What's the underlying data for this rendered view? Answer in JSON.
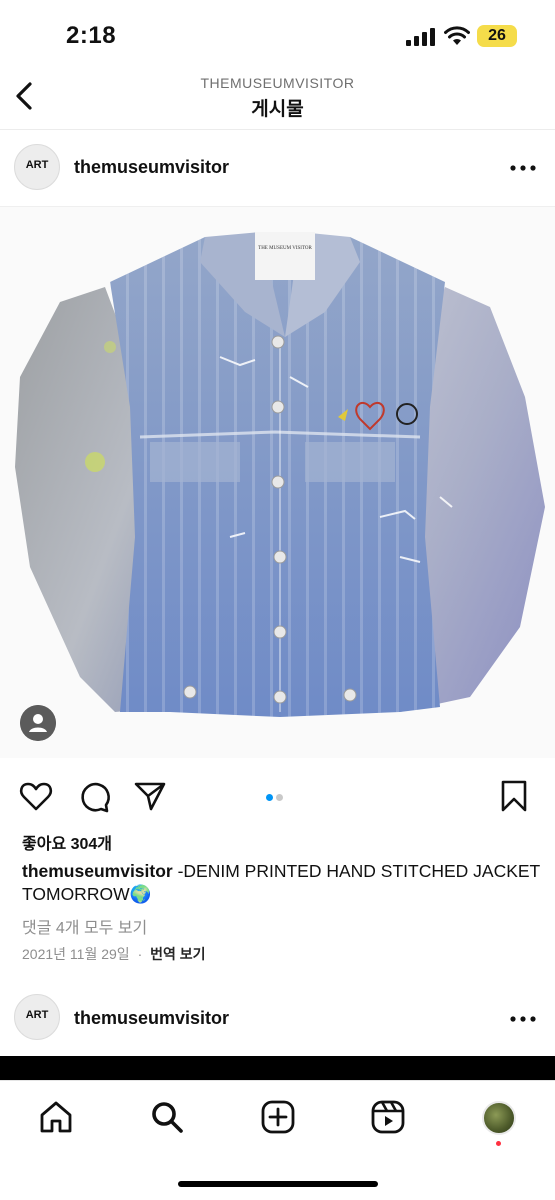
{
  "status_bar": {
    "time": "2:18",
    "battery": "26"
  },
  "header": {
    "account": "THEMUSEUMVISITOR",
    "title": "게시물"
  },
  "post": {
    "avatar_text": "ART",
    "username": "themuseumvisitor",
    "label_brand": "THE MUSEUM VISITOR",
    "image_count": 2,
    "active_image": 1,
    "likes": "좋아요 304개",
    "caption_user": "themuseumvisitor",
    "caption_text": " -DENIM PRINTED HAND STITCHED JACKET TOMORROW🌍",
    "comments_link": "댓글 4개 모두 보기",
    "date": "2021년 11월 29일",
    "separator": "·",
    "translate": "번역 보기"
  },
  "next_post": {
    "avatar_text": "ART",
    "username": "themuseumvisitor"
  },
  "tabbar": {
    "items": [
      "home-icon",
      "search-icon",
      "create-icon",
      "reels-icon",
      "profile"
    ]
  },
  "colors": {
    "accent": "#0095f6",
    "notification": "#ff3040",
    "battery": "#f5dc4a"
  }
}
